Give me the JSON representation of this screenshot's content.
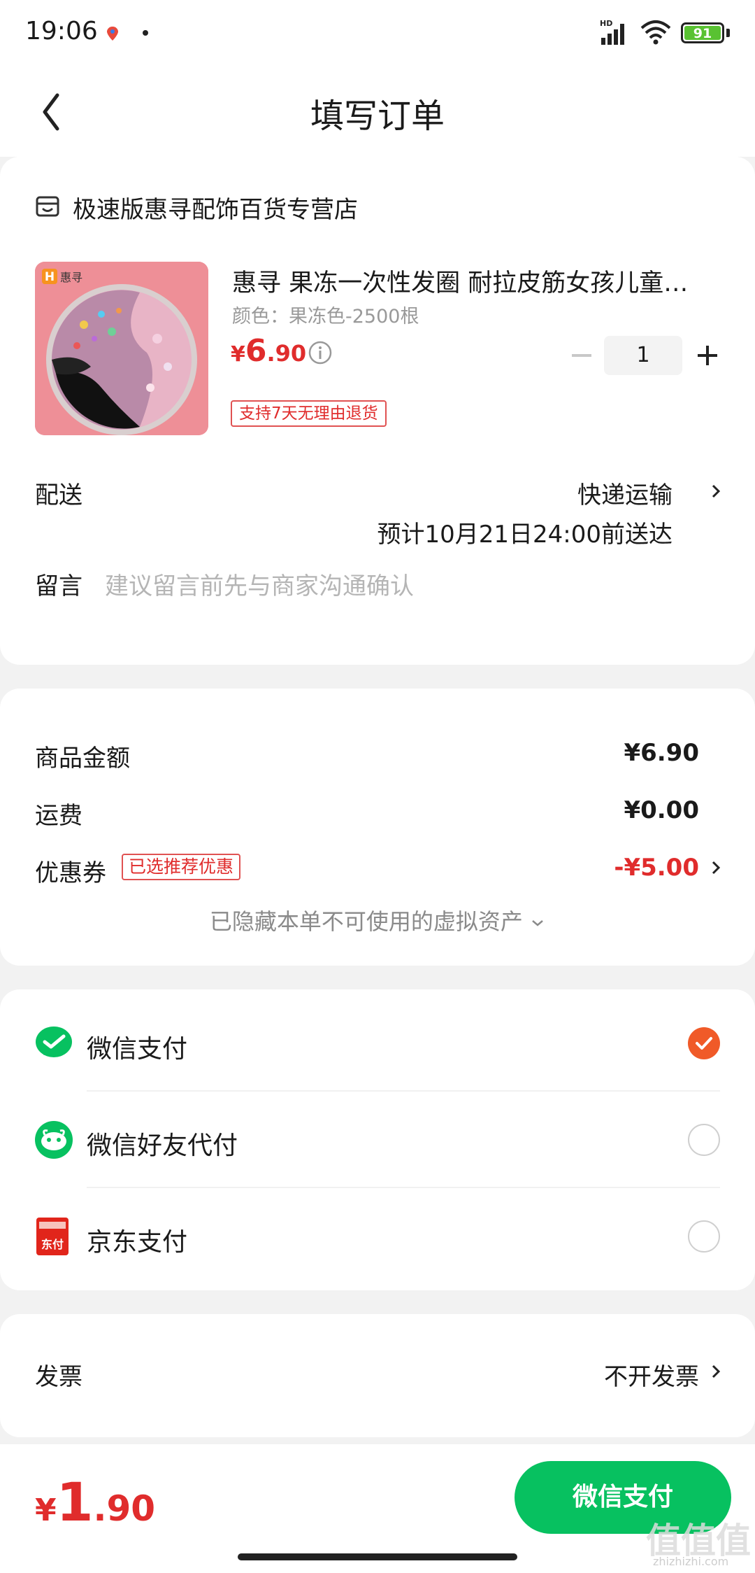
{
  "status_bar": {
    "time": "19:06",
    "battery": "91",
    "network": "HD"
  },
  "nav": {
    "title": "填写订单"
  },
  "store": {
    "name": "极速版惠寻配饰百货专营店"
  },
  "product": {
    "brand_badge": "惠寻",
    "title": "惠寻 果冻一次性发圈 耐拉皮筋女孩儿童…",
    "spec": "颜色：果冻色-2500根",
    "price_currency": "¥",
    "price_int": "6",
    "price_dec": ".90",
    "quantity": "1",
    "return_tag": "支持7天无理由退货"
  },
  "delivery": {
    "label": "配送",
    "method": "快递运输",
    "estimate": "预计10月21日24:00前送达"
  },
  "remark": {
    "label": "留言",
    "placeholder": "建议留言前先与商家沟通确认"
  },
  "summary": {
    "goods_label": "商品金额",
    "goods_value": "¥6.90",
    "shipping_label": "运费",
    "shipping_value": "¥0.00",
    "coupon_label": "优惠券",
    "coupon_tag": "已选推荐优惠",
    "coupon_value": "-¥5.00",
    "hidden_assets": "已隐藏本单不可使用的虚拟资产"
  },
  "payment": {
    "methods": [
      {
        "label": "微信支付",
        "selected": true
      },
      {
        "label": "微信好友代付",
        "selected": false
      },
      {
        "label": "京东支付",
        "selected": false
      }
    ],
    "jd_icon_text": "东付"
  },
  "invoice": {
    "label": "发票",
    "value": "不开发票"
  },
  "footer": {
    "total_currency": "¥",
    "total_int": "1",
    "total_dec": ".90",
    "pay_button": "微信支付"
  },
  "watermark": {
    "text": "值值值",
    "url": "zhizhizhi.com"
  },
  "colors": {
    "accent_red": "#e02c2c",
    "wechat_green": "#07c160",
    "check_orange": "#f05a28"
  }
}
